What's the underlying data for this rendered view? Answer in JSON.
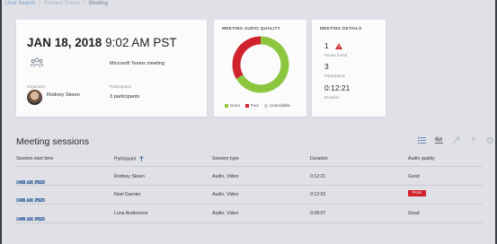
{
  "breadcrumb": {
    "item1": "User Search",
    "item2": "Related Teams",
    "item3": "Meeting",
    "sep": "/"
  },
  "summary": {
    "date": "JAN 18, 2018",
    "time": "9:02 AM PST",
    "meeting_type": "Microsoft Teams meeting",
    "organizer_label": "Organizer",
    "organizer_name": "Rodney Skeen",
    "participants_label": "Participants",
    "participants_value": "3 participants"
  },
  "quality": {
    "title": "MEETING AUDIO QUALITY",
    "legend": [
      {
        "label": "Good",
        "color": "#8cc63f"
      },
      {
        "label": "Poor",
        "color": "#d0232e"
      },
      {
        "label": "Unavailable",
        "color": "#cfd3d8"
      }
    ],
    "chart_data": {
      "type": "pie",
      "categories": [
        "Good",
        "Poor",
        "Unavailable"
      ],
      "values": [
        2,
        1,
        0
      ],
      "colors": [
        "#8cc63f",
        "#d0232e",
        "#cfd3d8"
      ]
    }
  },
  "details": {
    "title": "MEETING DETAILS",
    "issues_value": "1",
    "issues_label": "Issues found",
    "participants_value": "3",
    "participants_label": "Participants",
    "duration_value": "0:12:21",
    "duration_label": "Duration"
  },
  "sessions": {
    "title": "Meeting sessions",
    "columns": [
      "Session start time",
      "Participant",
      "Session type",
      "Duration",
      "Audio quality"
    ],
    "rows": [
      {
        "date": "JAN 18, 2018",
        "time": "9:02 AM PST",
        "participant": "Rodney Skeen",
        "type": "Audio, Video",
        "duration": "0:12:21",
        "quality": "Good"
      },
      {
        "date": "JAN 18, 2018",
        "time": "9:02 AM PST",
        "participant": "Noel Garnier",
        "type": "Audio, Video",
        "duration": "0:12:03",
        "quality": "Poor"
      },
      {
        "date": "JAN 18, 2018",
        "time": "9:06 AM PST",
        "participant": "Luna Andersson",
        "type": "Audio, Video",
        "duration": "0:08:07",
        "quality": "Good"
      }
    ]
  }
}
